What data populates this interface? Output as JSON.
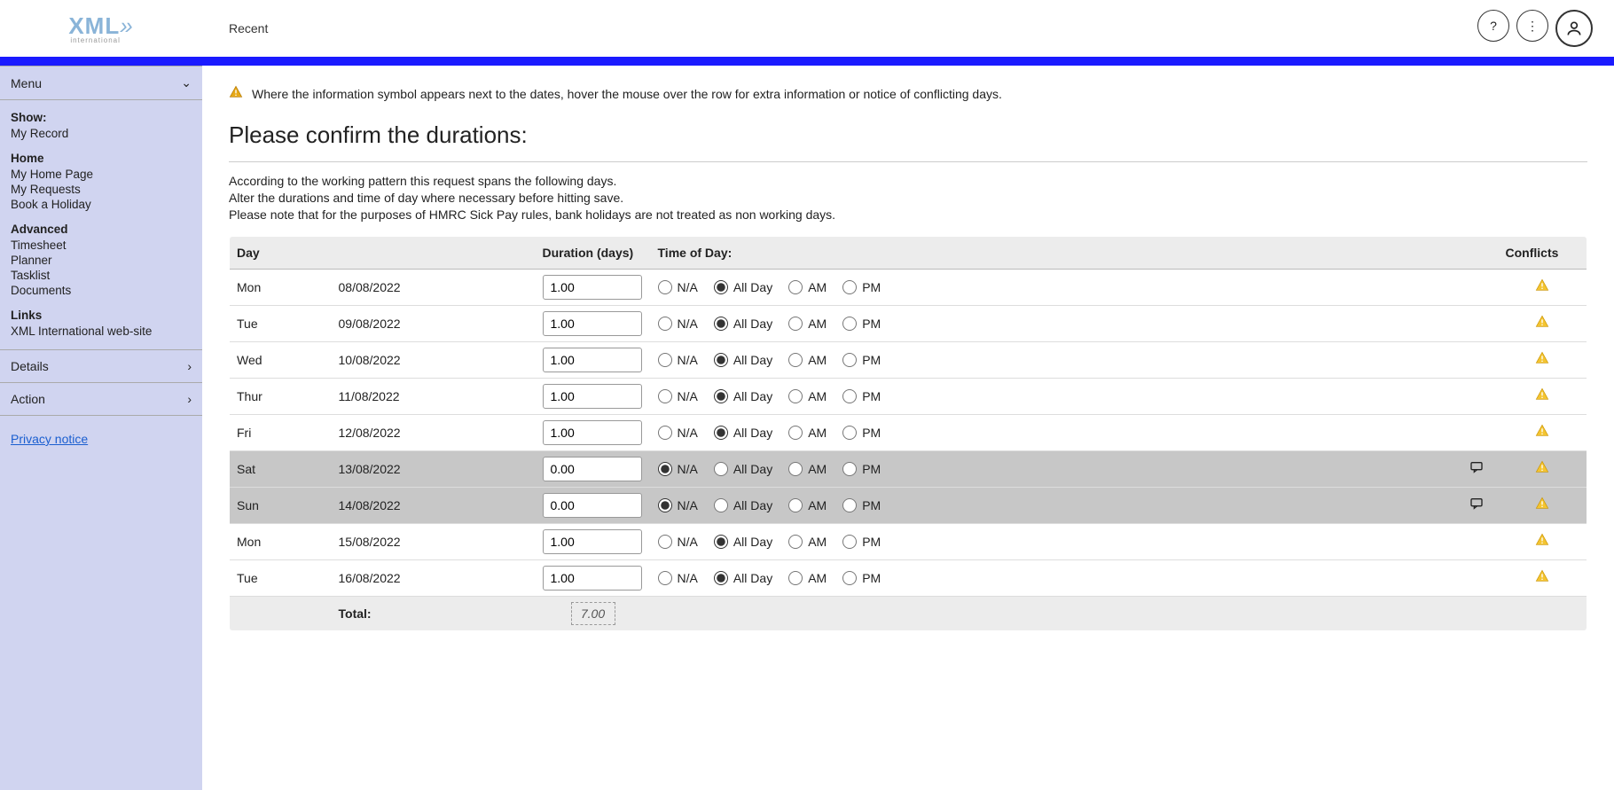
{
  "header": {
    "logo_main": "XML",
    "logo_arrows": "»",
    "logo_sub": "international",
    "recent": "Recent"
  },
  "sidebar": {
    "menu_label": "Menu",
    "groups": [
      {
        "title": "Show:",
        "items": [
          "My Record"
        ]
      },
      {
        "title": "Home",
        "items": [
          "My Home Page",
          "My Requests",
          "Book a Holiday"
        ]
      },
      {
        "title": "Advanced",
        "items": [
          "Timesheet",
          "Planner",
          "Tasklist",
          "Documents"
        ]
      },
      {
        "title": "Links",
        "items": [
          "XML International web-site"
        ]
      }
    ],
    "details_label": "Details",
    "action_label": "Action",
    "privacy_label": "Privacy notice"
  },
  "main": {
    "warning_text": "Where the information symbol appears next to the dates, hover the mouse over the row for extra information or notice of conflicting days.",
    "heading": "Please confirm the durations:",
    "desc1": "According to the working pattern this request spans the following days.",
    "desc2": "Alter the durations and time of day where necessary before hitting save.",
    "desc3": "Please note that for the purposes of HMRC Sick Pay rules, bank holidays are not treated as non working days."
  },
  "table": {
    "headers": {
      "day": "Day",
      "duration": "Duration (days)",
      "time": "Time of Day:",
      "conflicts": "Conflicts"
    },
    "options": {
      "na": "N/A",
      "allday": "All Day",
      "am": "AM",
      "pm": "PM"
    },
    "rows": [
      {
        "day": "Mon",
        "date": "08/08/2022",
        "duration": "1.00",
        "selected": "allday",
        "weekend": false,
        "note": false,
        "conflict": true
      },
      {
        "day": "Tue",
        "date": "09/08/2022",
        "duration": "1.00",
        "selected": "allday",
        "weekend": false,
        "note": false,
        "conflict": true
      },
      {
        "day": "Wed",
        "date": "10/08/2022",
        "duration": "1.00",
        "selected": "allday",
        "weekend": false,
        "note": false,
        "conflict": true
      },
      {
        "day": "Thur",
        "date": "11/08/2022",
        "duration": "1.00",
        "selected": "allday",
        "weekend": false,
        "note": false,
        "conflict": true
      },
      {
        "day": "Fri",
        "date": "12/08/2022",
        "duration": "1.00",
        "selected": "allday",
        "weekend": false,
        "note": false,
        "conflict": true
      },
      {
        "day": "Sat",
        "date": "13/08/2022",
        "duration": "0.00",
        "selected": "na",
        "weekend": true,
        "note": true,
        "conflict": true
      },
      {
        "day": "Sun",
        "date": "14/08/2022",
        "duration": "0.00",
        "selected": "na",
        "weekend": true,
        "note": true,
        "conflict": true
      },
      {
        "day": "Mon",
        "date": "15/08/2022",
        "duration": "1.00",
        "selected": "allday",
        "weekend": false,
        "note": false,
        "conflict": true
      },
      {
        "day": "Tue",
        "date": "16/08/2022",
        "duration": "1.00",
        "selected": "allday",
        "weekend": false,
        "note": false,
        "conflict": true
      }
    ],
    "total_label": "Total:",
    "total_value": "7.00"
  }
}
